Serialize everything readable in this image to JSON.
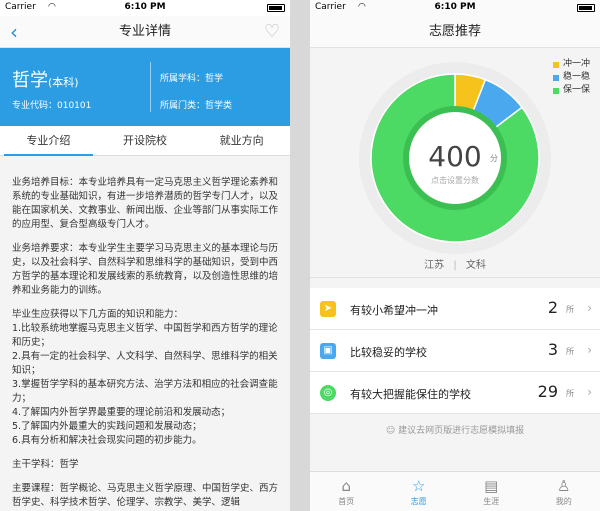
{
  "status": {
    "carrier": "Carrier",
    "time": "6:10 PM"
  },
  "left": {
    "nav_title": "专业详情",
    "major_name": "哲学",
    "major_level": "(本科)",
    "major_code": "专业代码：010101",
    "discipline": "所属学科：哲学",
    "category": "所属门类：哲学类",
    "tabs": [
      "专业介绍",
      "开设院校",
      "就业方向"
    ],
    "paragraphs": [
      "业务培养目标：本专业培养具有一定马克思主义哲学理论素养和系统的专业基础知识，有进一步培养潜质的哲学专门人才，以及能在国家机关、文教事业、新闻出版、企业等部门从事实际工作的应用型、复合型高级专门人才。",
      "业务培养要求：本专业学生主要学习马克思主义的基本理论与历史，以及社会科学、自然科学和思维科学的基础知识，受到中西方哲学的基本理论和发展线索的系统教育，以及创造性思维的培养和业务能力的训练。",
      "毕业生应获得以下几方面的知识和能力：\n1.比较系统地掌握马克思主义哲学、中国哲学和西方哲学的理论和历史；\n2.具有一定的社会科学、人文科学、自然科学、思维科学的相关知识；\n3.掌握哲学学科的基本研究方法、治学方法和相应的社会调查能力；\n4.了解国内外哲学界最重要的理论前沿和发展动态；\n5.了解国内外最重大的实践问题和发展动态；\n6.具有分析和解决社会现实问题的初步能力。",
      "主干学科：哲学",
      "主要课程：哲学概论、马克思主义哲学原理、中国哲学史、西方哲学史、科学技术哲学、伦理学、宗教学、美学、逻辑"
    ]
  },
  "right": {
    "nav_title": "志愿推荐",
    "legend": [
      {
        "label": "冲一冲",
        "color": "#f6c21c"
      },
      {
        "label": "稳一稳",
        "color": "#4aa8ef"
      },
      {
        "label": "保一保",
        "color": "#4cd964"
      }
    ],
    "score": "400",
    "score_unit": "分",
    "score_hint": "点击设置分数",
    "province": "江苏",
    "subject": "文科",
    "rows": [
      {
        "label": "有较小希望冲一冲",
        "count": "2",
        "unit": "所"
      },
      {
        "label": "比较稳妥的学校",
        "count": "3",
        "unit": "所"
      },
      {
        "label": "有较大把握能保住的学校",
        "count": "29",
        "unit": "所"
      }
    ],
    "tip": "建议去网页版进行志愿模拟填报",
    "tabbar": [
      "首页",
      "志愿",
      "生涯",
      "我的"
    ]
  },
  "chart_data": {
    "type": "pie",
    "categories": [
      "冲一冲",
      "稳一稳",
      "保一保"
    ],
    "values": [
      2,
      3,
      29
    ]
  }
}
